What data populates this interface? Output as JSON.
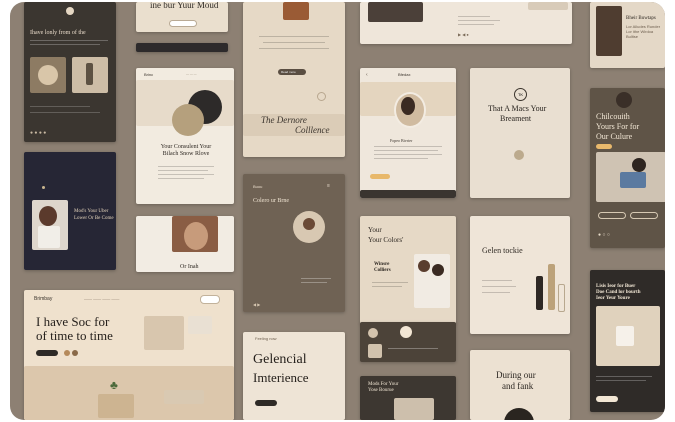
{
  "cards": {
    "c1": {
      "title": "Ihave lonly from of the"
    },
    "c2": {
      "title": "ine bur Yuur Moud"
    },
    "c3": {
      "headline": "The Dernore",
      "headline2": "Colllence",
      "button": "Read more"
    },
    "c5": {
      "title": "Bheir Buwtaps",
      "body": "Lor Alludes Runder Lor ithe Wirdoa Bulltse"
    },
    "c6": {
      "caption": "Mod's Your Uber Lower Or Be Come"
    },
    "c7": {
      "brand": "Brinc",
      "title": "Your Consulent Your Bilach Snow Rlove"
    },
    "c8": {
      "brand": "Buou",
      "title": "Colero ur Brne"
    },
    "c9": {
      "brand": "Bfedax",
      "caption": "Fopeo Bivrter"
    },
    "c10": {
      "title": "That A Macs Your",
      "title2": "Breament",
      "badge": "TK"
    },
    "c11": {
      "title": "Chilcouith",
      "title2": "Yours For for",
      "title3": "Our Culure",
      "button": "Read"
    },
    "c12": {
      "caption": "Or Inah"
    },
    "c13": {
      "title": "Your",
      "title2": "Your Colors'",
      "subtitle": "Winsre",
      "subtitle2": "Colliers"
    },
    "c14": {
      "title": "Gelen tockie"
    },
    "c15": {
      "brand": "Brimbay",
      "headline": "I have Soc for",
      "headline2": "of time to time",
      "button": "Shop now",
      "nav_button": "Contact"
    },
    "c16": {
      "kicker": "Feeling now",
      "headline": "Gelencial",
      "headline2": "Imterience",
      "button": "Book now"
    },
    "c17": {
      "title": "Lisis Ieor for Buer",
      "title2": "Doe Cand lor bourth",
      "title3": "Ieor Yeur Youre",
      "button": "Read more"
    },
    "c18": {
      "title": "During our",
      "title2": "and fank"
    },
    "c19": {
      "title": "Mods For Your",
      "title2": "Yose Bourue"
    }
  }
}
